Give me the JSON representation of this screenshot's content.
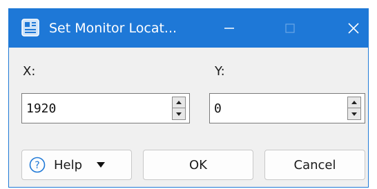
{
  "window": {
    "title": "Set Monitor Locat...",
    "icon": "app-icon",
    "controls": [
      "minimize-icon",
      "maximize-icon",
      "close-icon"
    ]
  },
  "fields": {
    "x": {
      "label": "X:",
      "value": "1920"
    },
    "y": {
      "label": "Y:",
      "value": "0"
    }
  },
  "buttons": {
    "help": "Help",
    "ok": "OK",
    "cancel": "Cancel"
  },
  "colors": {
    "titlebar": "#1e78d7",
    "dialog_bg": "#f0f0f0"
  }
}
